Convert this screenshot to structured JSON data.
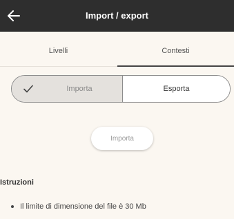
{
  "appbar": {
    "title": "Import / export",
    "back_icon": "arrow-left-icon",
    "background": "#2e2e2e"
  },
  "tabs": {
    "items": [
      {
        "label": "Livelli",
        "selected": false
      },
      {
        "label": "Contesti",
        "selected": true
      }
    ]
  },
  "mode_toggle": {
    "options": [
      {
        "label": "Importa",
        "selected": true,
        "icon": "check-icon"
      },
      {
        "label": "Esporta",
        "selected": false
      }
    ]
  },
  "action_button": {
    "label": "Importa",
    "enabled": false
  },
  "instructions": {
    "title": "Istruzioni",
    "items": [
      "Il limite di dimensione del file è 30 Mb"
    ]
  }
}
